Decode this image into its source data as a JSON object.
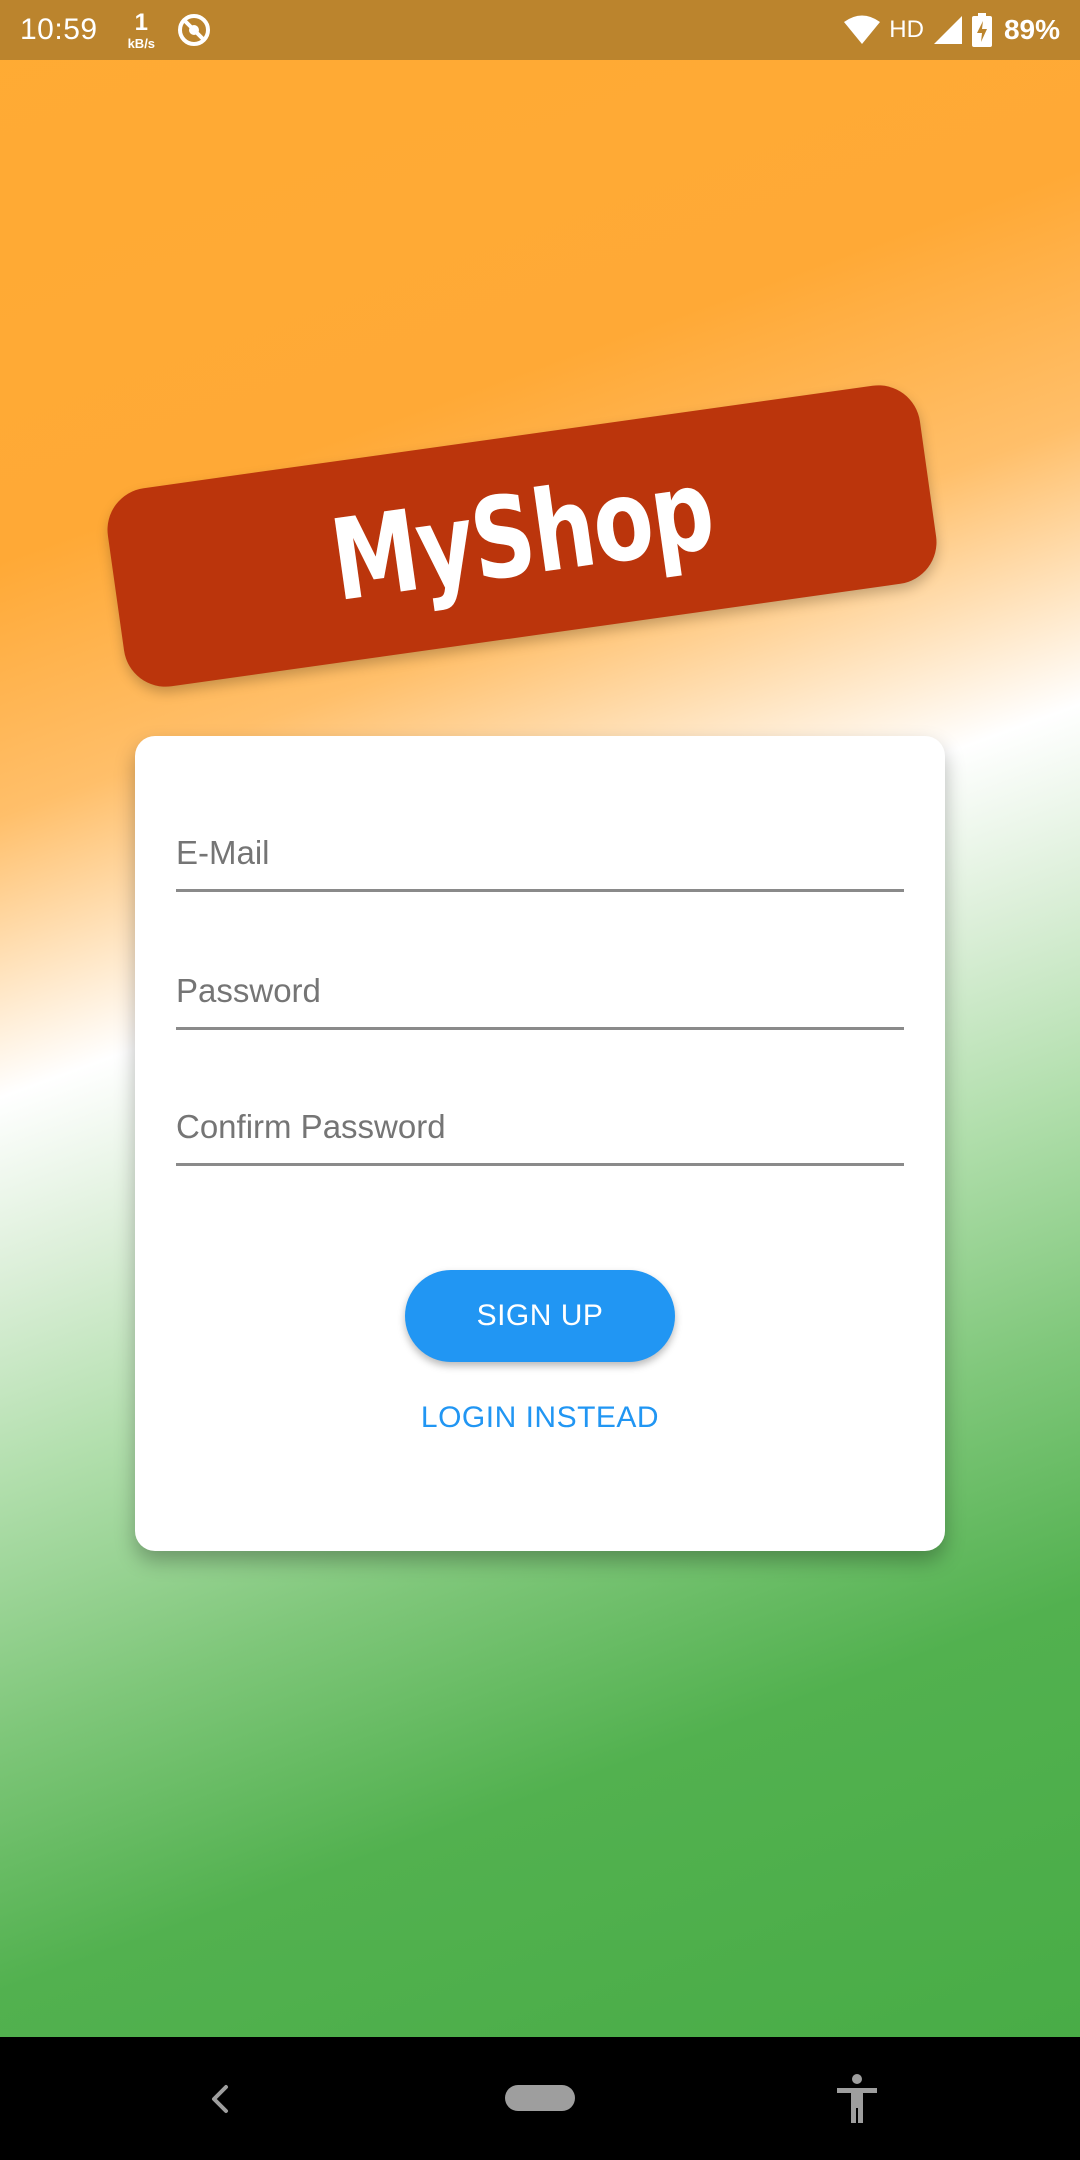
{
  "status_bar": {
    "time": "10:59",
    "net_speed_value": "1",
    "net_speed_unit": "kB/s",
    "network_type": "HD",
    "battery": "89%",
    "icons": [
      "dnd-icon",
      "wifi-icon",
      "signal-icon",
      "battery-charging-icon"
    ]
  },
  "app": {
    "logo_text": "MyShop"
  },
  "form": {
    "email_placeholder": "E-Mail",
    "password_placeholder": "Password",
    "confirm_password_placeholder": "Confirm Password",
    "signup_label": "SIGN UP",
    "login_instead_label": "LOGIN INSTEAD"
  },
  "nav_bar": {
    "icons": [
      "back-icon",
      "home-pill-icon",
      "accessibility-icon"
    ]
  },
  "colors": {
    "status_bar": "#bb842d",
    "logo_badge": "#bb350c",
    "accent": "#2196f3",
    "gradient_top": "#ffab33",
    "gradient_bottom": "#46ab44"
  }
}
